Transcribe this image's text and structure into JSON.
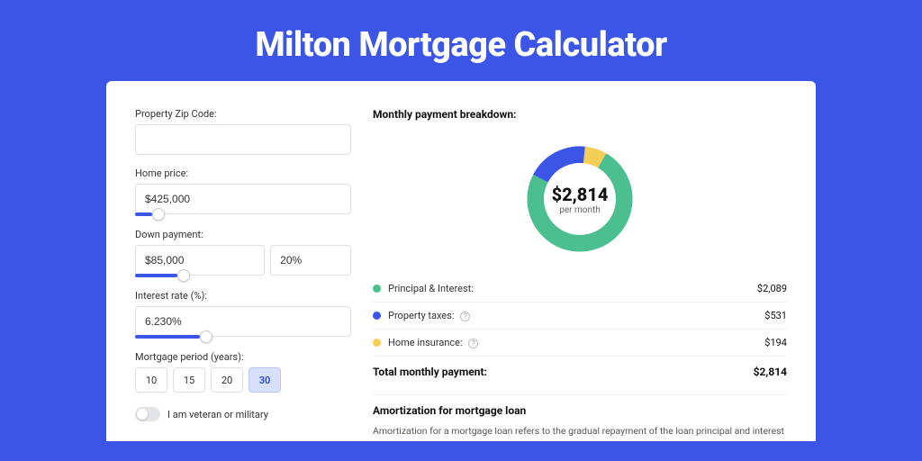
{
  "title": "Milton Mortgage Calculator",
  "form": {
    "zip": {
      "label": "Property Zip Code:",
      "value": ""
    },
    "home_price": {
      "label": "Home price:",
      "value": "$425,000",
      "slider_pct": 8
    },
    "down_payment": {
      "label": "Down payment:",
      "amount": "$85,000",
      "percent": "20%",
      "slider_pct": 20
    },
    "interest_rate": {
      "label": "Interest rate (%):",
      "value": "6.230%",
      "slider_pct": 30
    },
    "period": {
      "label": "Mortgage period (years):",
      "options": [
        "10",
        "15",
        "20",
        "30"
      ],
      "selected": "30"
    },
    "veteran": {
      "label": "I am veteran or military",
      "on": false
    }
  },
  "breakdown": {
    "title": "Monthly payment breakdown:",
    "center_amount": "$2,814",
    "center_sub": "per month",
    "items": [
      {
        "key": "principal_interest",
        "label": "Principal & Interest:",
        "value": "$2,089",
        "color": "#4bbf8f",
        "help": false,
        "pct": 74.2
      },
      {
        "key": "property_taxes",
        "label": "Property taxes:",
        "value": "$531",
        "color": "#3b55e6",
        "help": true,
        "pct": 18.9
      },
      {
        "key": "home_insurance",
        "label": "Home insurance:",
        "value": "$194",
        "color": "#f3cf57",
        "help": true,
        "pct": 6.9
      }
    ],
    "total_label": "Total monthly payment:",
    "total_value": "$2,814"
  },
  "chart_data": {
    "type": "pie",
    "title": "Monthly payment breakdown",
    "categories": [
      "Principal & Interest",
      "Property taxes",
      "Home insurance"
    ],
    "values": [
      2089,
      531,
      194
    ],
    "colors": [
      "#4bbf8f",
      "#3b55e6",
      "#f3cf57"
    ],
    "total": 2814,
    "center_label": "$2,814 per month"
  },
  "amortization": {
    "title": "Amortization for mortgage loan",
    "text": "Amortization for a mortgage loan refers to the gradual repayment of the loan principal and interest over a specified"
  }
}
